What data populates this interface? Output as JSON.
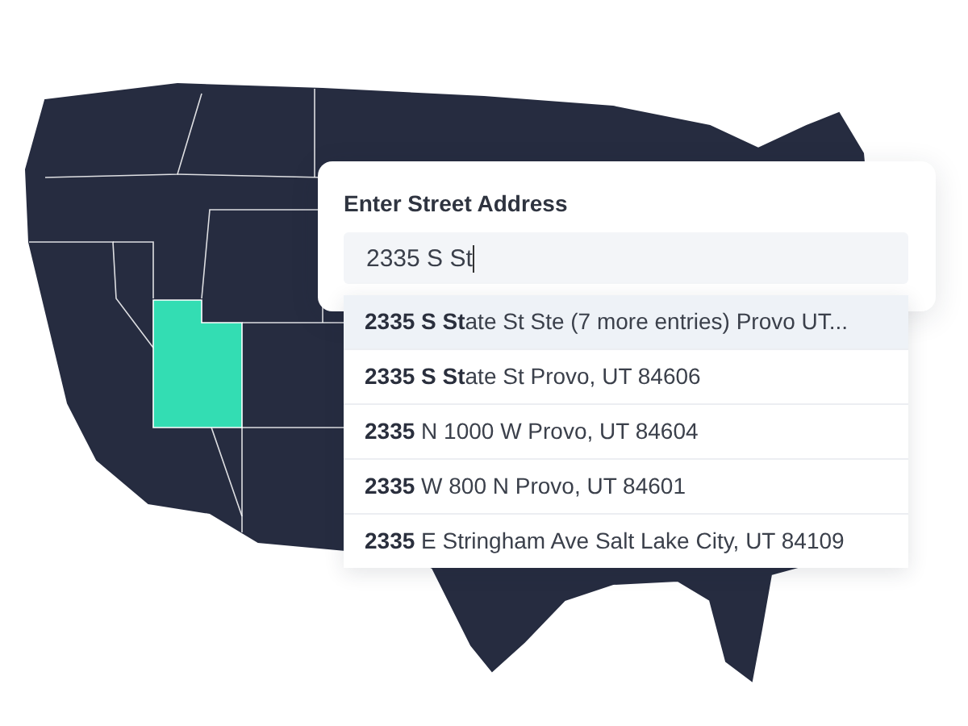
{
  "address_field": {
    "label": "Enter Street Address",
    "value": "2335 S St",
    "focused": true
  },
  "suggestions": [
    {
      "text": "**2335 S St**ate St Ste (7 more entries) Provo UT...",
      "selected": true
    },
    {
      "text": "**2335 S St**ate St Provo, UT 84606",
      "selected": false
    },
    {
      "text": "**2335** N 1000 W Provo, UT 84604",
      "selected": false
    },
    {
      "text": "**2335** W 800 N Provo, UT 84601",
      "selected": false
    },
    {
      "text": "**2335** E Stringham Ave Salt Lake City, UT 84109",
      "selected": false
    }
  ]
}
